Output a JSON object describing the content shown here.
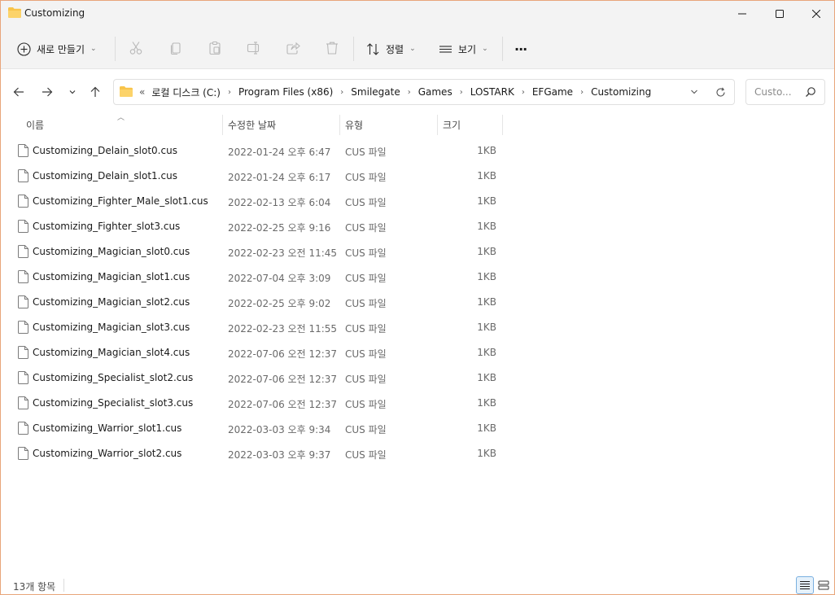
{
  "window": {
    "title": "Customizing"
  },
  "toolbar": {
    "new_label": "새로 만들기",
    "sort_label": "정렬",
    "view_label": "보기",
    "more_label": "···"
  },
  "address": {
    "overflow": "«",
    "crumbs": [
      "로컬 디스크 (C:)",
      "Program Files (x86)",
      "Smilegate",
      "Games",
      "LOSTARK",
      "EFGame",
      "Customizing"
    ]
  },
  "search": {
    "placeholder": "Custo..."
  },
  "columns": {
    "name": "이름",
    "date": "수정한 날짜",
    "type": "유형",
    "size": "크기"
  },
  "files": [
    {
      "name": "Customizing_Delain_slot0.cus",
      "date": "2022-01-24 오후 6:47",
      "type": "CUS 파일",
      "size": "1KB"
    },
    {
      "name": "Customizing_Delain_slot1.cus",
      "date": "2022-01-24 오후 6:17",
      "type": "CUS 파일",
      "size": "1KB"
    },
    {
      "name": "Customizing_Fighter_Male_slot1.cus",
      "date": "2022-02-13 오후 6:04",
      "type": "CUS 파일",
      "size": "1KB"
    },
    {
      "name": "Customizing_Fighter_slot3.cus",
      "date": "2022-02-25 오후 9:16",
      "type": "CUS 파일",
      "size": "1KB"
    },
    {
      "name": "Customizing_Magician_slot0.cus",
      "date": "2022-02-23 오전 11:45",
      "type": "CUS 파일",
      "size": "1KB"
    },
    {
      "name": "Customizing_Magician_slot1.cus",
      "date": "2022-07-04 오후 3:09",
      "type": "CUS 파일",
      "size": "1KB"
    },
    {
      "name": "Customizing_Magician_slot2.cus",
      "date": "2022-02-25 오후 9:02",
      "type": "CUS 파일",
      "size": "1KB"
    },
    {
      "name": "Customizing_Magician_slot3.cus",
      "date": "2022-02-23 오전 11:55",
      "type": "CUS 파일",
      "size": "1KB"
    },
    {
      "name": "Customizing_Magician_slot4.cus",
      "date": "2022-07-06 오전 12:37",
      "type": "CUS 파일",
      "size": "1KB"
    },
    {
      "name": "Customizing_Specialist_slot2.cus",
      "date": "2022-07-06 오전 12:37",
      "type": "CUS 파일",
      "size": "1KB"
    },
    {
      "name": "Customizing_Specialist_slot3.cus",
      "date": "2022-07-06 오전 12:37",
      "type": "CUS 파일",
      "size": "1KB"
    },
    {
      "name": "Customizing_Warrior_slot1.cus",
      "date": "2022-03-03 오후 9:34",
      "type": "CUS 파일",
      "size": "1KB"
    },
    {
      "name": "Customizing_Warrior_slot2.cus",
      "date": "2022-03-03 오후 9:37",
      "type": "CUS 파일",
      "size": "1KB"
    }
  ],
  "status": {
    "item_count": "13개 항목"
  },
  "colors": {
    "folder": "#f8c44a",
    "window_border": "#e8a57a",
    "chrome_bg": "#f3f3f3"
  }
}
